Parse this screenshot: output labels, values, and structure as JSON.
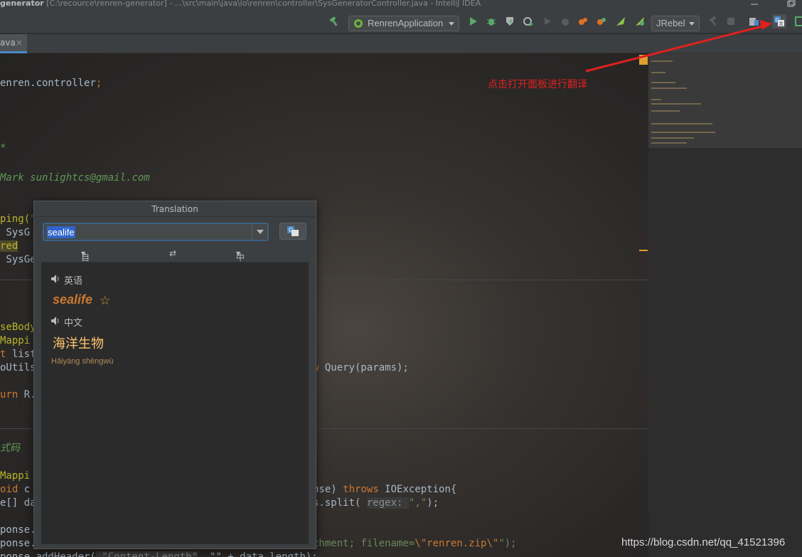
{
  "window": {
    "project": "generator",
    "title_rest": " [C:\\recource\\renren-generator] - ...\\src\\main\\java\\io\\renren\\controller\\SysGeneratorController.java - IntelliJ IDEA"
  },
  "toolbar": {
    "run_config": "RenrenApplication",
    "jrebel": "JRebel"
  },
  "tab": {
    "label": "ava",
    "close": "×"
  },
  "code": {
    "line1_plain": "enren.controller",
    "line1_semi": ";",
    "line2": "*",
    "line3_a": "Mark ",
    "line3_b": "sunlightcs@gmail.com",
    "line4_a": "ping(",
    "line4_b": "\"",
    "line5": " SysG",
    "line6": "red",
    "line7": " SysGe",
    "line8": "seBody",
    "line9": "Mappi",
    "line10_a": "t ",
    "line10_b": "list",
    "line11": "oUtils",
    "line11_r_kw": "w ",
    "line11_r": "Query(params);",
    "line12_a": "urn ",
    "line12_b": "R.",
    "line13": "式码",
    "line14": "Mappi",
    "line15_a": "oid ",
    "line15_b": "c",
    "line15_r_a": "nse) ",
    "line15_r_kw": "throws ",
    "line15_r_b": "IOException{",
    "line16": "e[] da",
    "line16_r_a": "s.split( ",
    "line16_hint": "regex: ",
    "line16_str": "\",\"",
    "line16_end": ");",
    "line17": "ponse.",
    "line18": "ponse.",
    "line18_r_a": "chment; filename=",
    "line18_r_str": "\\\"renren.zip\\\"",
    "line18_r_end": "\");",
    "line19": "ponse.addHeader(",
    "line19_hint": " \"Content-Length\"",
    "line19_b": ", \"\" + data.length);"
  },
  "popup": {
    "title": "Translation",
    "search_value": "sealife",
    "source_lang": "自动检测",
    "target_lang": "中文",
    "swap": "⇄",
    "source_label": "英语",
    "word": "sealife",
    "target_label": "中文",
    "translation": "海洋生物",
    "pinyin": "Hǎiyáng shēngwù"
  },
  "annotation": "点击打开面板进行翻译",
  "watermark": "https://blog.csdn.net/qq_41521396",
  "colors": {
    "annotation": "#e02020",
    "accent": "#4a88c7",
    "keyword": "#cc7832"
  }
}
